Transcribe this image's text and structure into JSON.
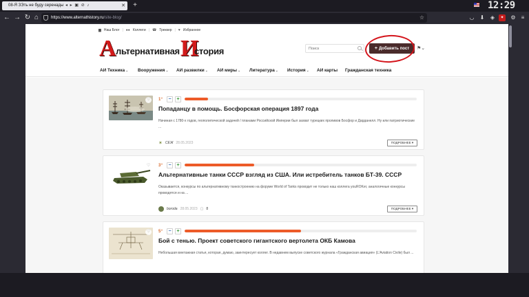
{
  "browser": {
    "tab_title": "08-Я ЗЭть не буду серенады",
    "new_tab_label": "+",
    "clock": "12:29",
    "url_host": "https://www.alternathistory.ru",
    "url_path": "/site-blog/",
    "icons": [
      "back-icon",
      "forward-icon",
      "reload-icon",
      "home-icon",
      "shield-icon",
      "star-icon",
      "pocket-icon",
      "download-icon",
      "extension-icon",
      "menu-icon"
    ]
  },
  "site": {
    "topnav": [
      {
        "icon": "book",
        "label": "Наш Блог"
      },
      {
        "icon": "people",
        "label": "Коллеги"
      },
      {
        "icon": "phone",
        "label": "Треккер"
      },
      {
        "icon": "heart",
        "label": "Избранное"
      }
    ],
    "logo": {
      "letter1": "А",
      "word1": "льтернативная",
      "letter2": "И",
      "word2": "стория"
    },
    "search_placeholder": "Поиск",
    "add_post_label": "Добавить пост",
    "add_post_plus": "+",
    "mainnav": [
      {
        "label": "АИ Техника",
        "dropdown": true
      },
      {
        "label": "Вооружения",
        "dropdown": true
      },
      {
        "label": "АИ развилки",
        "dropdown": true
      },
      {
        "label": "АИ миры",
        "dropdown": true
      },
      {
        "label": "Литература",
        "dropdown": true
      },
      {
        "label": "История",
        "dropdown": true
      },
      {
        "label": "АИ карты",
        "dropdown": false
      },
      {
        "label": "Гражданская техника",
        "dropdown": false
      }
    ],
    "accent_color": "#ed5b28",
    "chevron": "⌄"
  },
  "posts": [
    {
      "rating": "1",
      "rating_fill": 0.1,
      "title": "Попаданцу в помощь. Босфорская операция 1897 года",
      "excerpt": "Начиная с 1780-х годов, геополитической задачей / планами Российской Империи был захват турецких проливов Босфор и Дарданелл. Ну или патриотические ...",
      "author": "СЕЖ",
      "date": "28.05.2023",
      "comments": "",
      "more_label": "ПОДРОБНЕЕ ▾",
      "thumb": "ships"
    },
    {
      "rating": "3",
      "rating_fill": 0.3,
      "title": "Альтернативные танки СССР взгляд из США. Или истребитель танков БТ-39. СССР",
      "excerpt": "Оказывается, конкурсы по альтернативному танкостроению на форуме World of Tanks проводит не только наш коллега youROKer, аналогичные конкурсы проводятся и на ...",
      "author": "boroda",
      "date": "28.05.2023",
      "comments": "8",
      "more_label": "ПОДРОБНЕЕ ▾",
      "thumb": "tank"
    },
    {
      "rating": "5",
      "rating_fill": 0.5,
      "title": "Бой с тенью. Проект советского гигантского вертолета ОКБ Камова",
      "excerpt": "Небольшая винтажная статья, которая, думаю, заинтересует коллег. В недавнем выпуске советского журнала «Гражданская авиация» (L'Aviation Civile) был ...",
      "author": "",
      "date": "",
      "comments": "",
      "more_label": "",
      "thumb": "blueprint"
    }
  ]
}
